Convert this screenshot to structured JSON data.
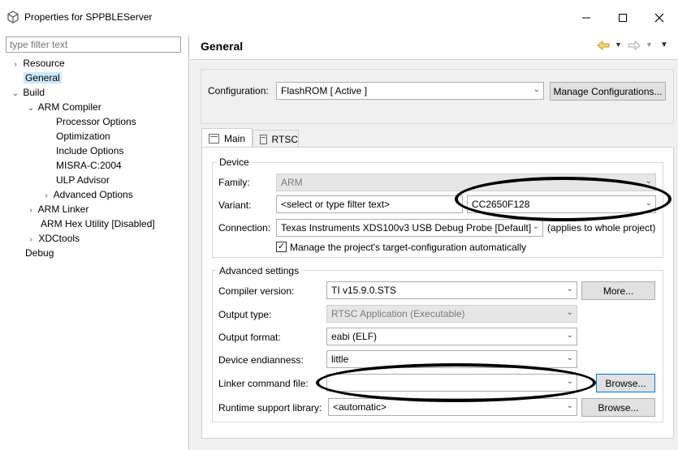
{
  "window": {
    "title": "Properties for SPPBLEServer",
    "minimize_icon": "minimize-icon",
    "maximize_icon": "maximize-icon",
    "close_icon": "close-icon"
  },
  "filter": {
    "placeholder": "type filter text"
  },
  "tree": {
    "items": [
      {
        "label": "Resource"
      },
      {
        "label": "General"
      },
      {
        "label": "Build"
      },
      {
        "label": "ARM Compiler"
      },
      {
        "label": "Processor Options"
      },
      {
        "label": "Optimization"
      },
      {
        "label": "Include Options"
      },
      {
        "label": "MISRA-C:2004"
      },
      {
        "label": "ULP Advisor"
      },
      {
        "label": "Advanced Options"
      },
      {
        "label": "ARM Linker"
      },
      {
        "label": "ARM Hex Utility  [Disabled]"
      },
      {
        "label": "XDCtools"
      },
      {
        "label": "Debug"
      }
    ]
  },
  "page": {
    "title": "General"
  },
  "config": {
    "label": "Configuration:",
    "value": "FlashROM  [ Active ]",
    "manage_button": "Manage Configurations..."
  },
  "tabs": {
    "main": "Main",
    "rtsc": "RTSC"
  },
  "device": {
    "group_title": "Device",
    "family_label": "Family:",
    "family_value": "ARM",
    "variant_label": "Variant:",
    "variant_filter": "<select or type filter text>",
    "variant_value": "CC2650F128",
    "connection_label": "Connection:",
    "connection_value": "Texas Instruments XDS100v3 USB Debug Probe [Default]",
    "connection_note": "(applies to whole project)",
    "manage_target_label": "Manage the project's target-configuration automatically",
    "manage_target_checked": true
  },
  "advanced": {
    "group_title": "Advanced settings",
    "compiler_label": "Compiler version:",
    "compiler_value": "TI v15.9.0.STS",
    "more_button": "More...",
    "output_type_label": "Output type:",
    "output_type_value": "RTSC Application (Executable)",
    "output_format_label": "Output format:",
    "output_format_value": "eabi (ELF)",
    "endianness_label": "Device endianness:",
    "endianness_value": "little",
    "linker_cmd_label": "Linker command file:",
    "linker_cmd_value": "",
    "linker_browse": "Browse...",
    "runtime_label": "Runtime support library:",
    "runtime_value": "<automatic>",
    "runtime_browse": "Browse..."
  }
}
